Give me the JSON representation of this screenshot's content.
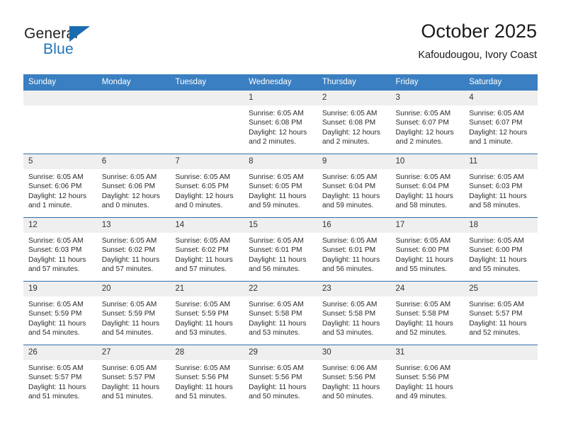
{
  "brand": {
    "name_top": "General",
    "name_bottom": "Blue",
    "flag_icon": "blue-triangle-flag",
    "accent_color": "#1a6cb0"
  },
  "header": {
    "title": "October 2025",
    "subtitle": "Kafoudougou, Ivory Coast"
  },
  "theme": {
    "header_row_color": "#3a7fc1",
    "row_divider_color": "#2f6fab",
    "daynum_band_color": "#efefef"
  },
  "labels": {
    "sunrise_prefix": "Sunrise:",
    "sunset_prefix": "Sunset:",
    "daylight_prefix": "Daylight:"
  },
  "weekday_headers": [
    "Sunday",
    "Monday",
    "Tuesday",
    "Wednesday",
    "Thursday",
    "Friday",
    "Saturday"
  ],
  "weeks": [
    [
      {
        "day": "",
        "blank": true
      },
      {
        "day": "",
        "blank": true
      },
      {
        "day": "",
        "blank": true
      },
      {
        "day": "1",
        "sunrise": "Sunrise: 6:05 AM",
        "sunset": "Sunset: 6:08 PM",
        "daylight": "Daylight: 12 hours and 2 minutes."
      },
      {
        "day": "2",
        "sunrise": "Sunrise: 6:05 AM",
        "sunset": "Sunset: 6:08 PM",
        "daylight": "Daylight: 12 hours and 2 minutes."
      },
      {
        "day": "3",
        "sunrise": "Sunrise: 6:05 AM",
        "sunset": "Sunset: 6:07 PM",
        "daylight": "Daylight: 12 hours and 2 minutes."
      },
      {
        "day": "4",
        "sunrise": "Sunrise: 6:05 AM",
        "sunset": "Sunset: 6:07 PM",
        "daylight": "Daylight: 12 hours and 1 minute."
      }
    ],
    [
      {
        "day": "5",
        "sunrise": "Sunrise: 6:05 AM",
        "sunset": "Sunset: 6:06 PM",
        "daylight": "Daylight: 12 hours and 1 minute."
      },
      {
        "day": "6",
        "sunrise": "Sunrise: 6:05 AM",
        "sunset": "Sunset: 6:06 PM",
        "daylight": "Daylight: 12 hours and 0 minutes."
      },
      {
        "day": "7",
        "sunrise": "Sunrise: 6:05 AM",
        "sunset": "Sunset: 6:05 PM",
        "daylight": "Daylight: 12 hours and 0 minutes."
      },
      {
        "day": "8",
        "sunrise": "Sunrise: 6:05 AM",
        "sunset": "Sunset: 6:05 PM",
        "daylight": "Daylight: 11 hours and 59 minutes."
      },
      {
        "day": "9",
        "sunrise": "Sunrise: 6:05 AM",
        "sunset": "Sunset: 6:04 PM",
        "daylight": "Daylight: 11 hours and 59 minutes."
      },
      {
        "day": "10",
        "sunrise": "Sunrise: 6:05 AM",
        "sunset": "Sunset: 6:04 PM",
        "daylight": "Daylight: 11 hours and 58 minutes."
      },
      {
        "day": "11",
        "sunrise": "Sunrise: 6:05 AM",
        "sunset": "Sunset: 6:03 PM",
        "daylight": "Daylight: 11 hours and 58 minutes."
      }
    ],
    [
      {
        "day": "12",
        "sunrise": "Sunrise: 6:05 AM",
        "sunset": "Sunset: 6:03 PM",
        "daylight": "Daylight: 11 hours and 57 minutes."
      },
      {
        "day": "13",
        "sunrise": "Sunrise: 6:05 AM",
        "sunset": "Sunset: 6:02 PM",
        "daylight": "Daylight: 11 hours and 57 minutes."
      },
      {
        "day": "14",
        "sunrise": "Sunrise: 6:05 AM",
        "sunset": "Sunset: 6:02 PM",
        "daylight": "Daylight: 11 hours and 57 minutes."
      },
      {
        "day": "15",
        "sunrise": "Sunrise: 6:05 AM",
        "sunset": "Sunset: 6:01 PM",
        "daylight": "Daylight: 11 hours and 56 minutes."
      },
      {
        "day": "16",
        "sunrise": "Sunrise: 6:05 AM",
        "sunset": "Sunset: 6:01 PM",
        "daylight": "Daylight: 11 hours and 56 minutes."
      },
      {
        "day": "17",
        "sunrise": "Sunrise: 6:05 AM",
        "sunset": "Sunset: 6:00 PM",
        "daylight": "Daylight: 11 hours and 55 minutes."
      },
      {
        "day": "18",
        "sunrise": "Sunrise: 6:05 AM",
        "sunset": "Sunset: 6:00 PM",
        "daylight": "Daylight: 11 hours and 55 minutes."
      }
    ],
    [
      {
        "day": "19",
        "sunrise": "Sunrise: 6:05 AM",
        "sunset": "Sunset: 5:59 PM",
        "daylight": "Daylight: 11 hours and 54 minutes."
      },
      {
        "day": "20",
        "sunrise": "Sunrise: 6:05 AM",
        "sunset": "Sunset: 5:59 PM",
        "daylight": "Daylight: 11 hours and 54 minutes."
      },
      {
        "day": "21",
        "sunrise": "Sunrise: 6:05 AM",
        "sunset": "Sunset: 5:59 PM",
        "daylight": "Daylight: 11 hours and 53 minutes."
      },
      {
        "day": "22",
        "sunrise": "Sunrise: 6:05 AM",
        "sunset": "Sunset: 5:58 PM",
        "daylight": "Daylight: 11 hours and 53 minutes."
      },
      {
        "day": "23",
        "sunrise": "Sunrise: 6:05 AM",
        "sunset": "Sunset: 5:58 PM",
        "daylight": "Daylight: 11 hours and 53 minutes."
      },
      {
        "day": "24",
        "sunrise": "Sunrise: 6:05 AM",
        "sunset": "Sunset: 5:58 PM",
        "daylight": "Daylight: 11 hours and 52 minutes."
      },
      {
        "day": "25",
        "sunrise": "Sunrise: 6:05 AM",
        "sunset": "Sunset: 5:57 PM",
        "daylight": "Daylight: 11 hours and 52 minutes."
      }
    ],
    [
      {
        "day": "26",
        "sunrise": "Sunrise: 6:05 AM",
        "sunset": "Sunset: 5:57 PM",
        "daylight": "Daylight: 11 hours and 51 minutes."
      },
      {
        "day": "27",
        "sunrise": "Sunrise: 6:05 AM",
        "sunset": "Sunset: 5:57 PM",
        "daylight": "Daylight: 11 hours and 51 minutes."
      },
      {
        "day": "28",
        "sunrise": "Sunrise: 6:05 AM",
        "sunset": "Sunset: 5:56 PM",
        "daylight": "Daylight: 11 hours and 51 minutes."
      },
      {
        "day": "29",
        "sunrise": "Sunrise: 6:05 AM",
        "sunset": "Sunset: 5:56 PM",
        "daylight": "Daylight: 11 hours and 50 minutes."
      },
      {
        "day": "30",
        "sunrise": "Sunrise: 6:06 AM",
        "sunset": "Sunset: 5:56 PM",
        "daylight": "Daylight: 11 hours and 50 minutes."
      },
      {
        "day": "31",
        "sunrise": "Sunrise: 6:06 AM",
        "sunset": "Sunset: 5:56 PM",
        "daylight": "Daylight: 11 hours and 49 minutes."
      },
      {
        "day": "",
        "blank": true
      }
    ]
  ]
}
